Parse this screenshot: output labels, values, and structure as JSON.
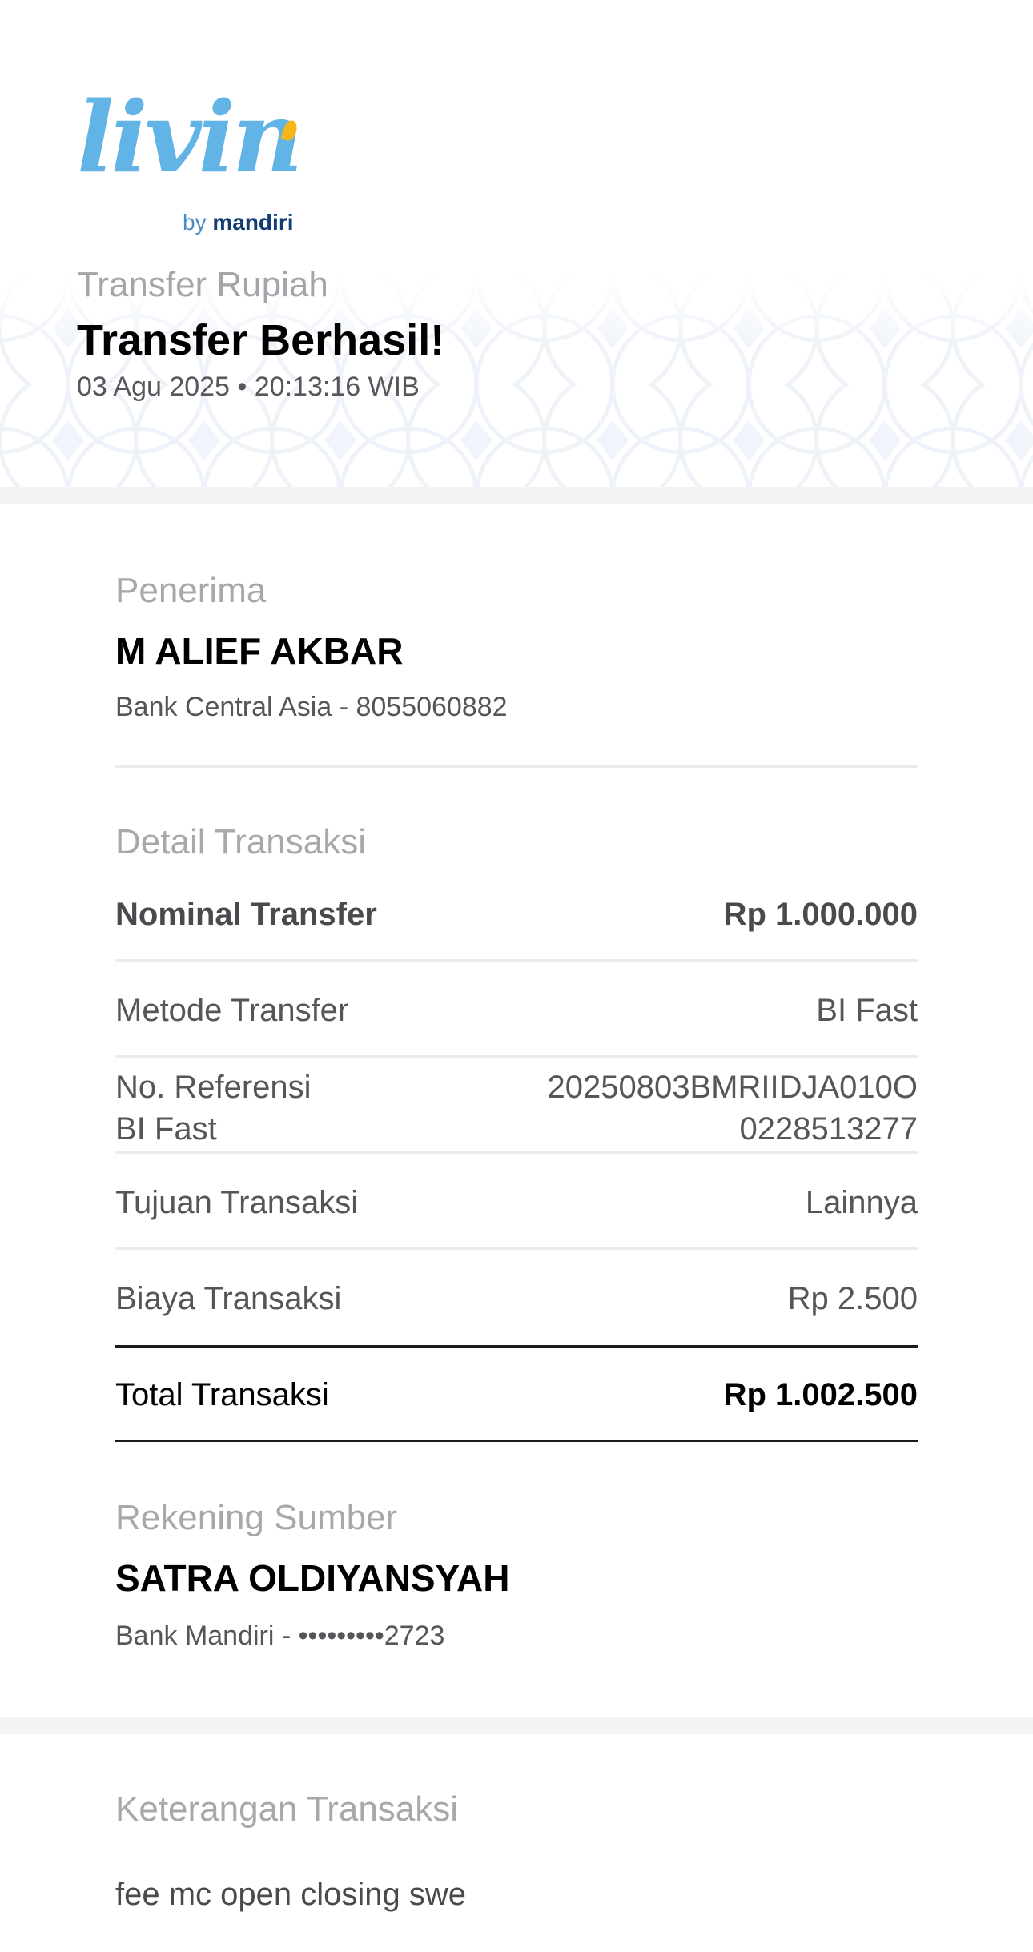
{
  "colors": {
    "logo_blue": "#63b4e6",
    "logo_accent": "#f6b716",
    "brand_navy": "#123d72",
    "muted_label": "#a8a8ac",
    "body_text": "#56565a"
  },
  "logo": {
    "word": "livin",
    "by": "by",
    "brand": "mandiri"
  },
  "header": {
    "label": "Transfer Rupiah",
    "title": "Transfer Berhasil!",
    "datetime": "03 Agu 2025 • 20:13:16 WIB"
  },
  "recipient": {
    "label": "Penerima",
    "name": "M ALIEF AKBAR",
    "bank_account": "Bank Central Asia - 8055060882"
  },
  "details": {
    "label": "Detail Transaksi",
    "rows": [
      {
        "label": "Nominal Transfer",
        "value": "Rp 1.000.000"
      },
      {
        "label": "Metode Transfer",
        "value": "BI Fast"
      },
      {
        "label": "No. Referensi\nBI Fast",
        "value": "20250803BMRIIDJA010O\n0228513277"
      },
      {
        "label": "Tujuan Transaksi",
        "value": "Lainnya"
      },
      {
        "label": "Biaya Transaksi",
        "value": "Rp 2.500"
      },
      {
        "label": "Total Transaksi",
        "value": "Rp 1.002.500"
      }
    ]
  },
  "source": {
    "label": "Rekening Sumber",
    "name": "SATRA OLDIYANSYAH",
    "bank_account": "Bank Mandiri - •••••••••2723"
  },
  "notes": {
    "label": "Keterangan Transaksi",
    "text": "fee mc open closing swe"
  }
}
